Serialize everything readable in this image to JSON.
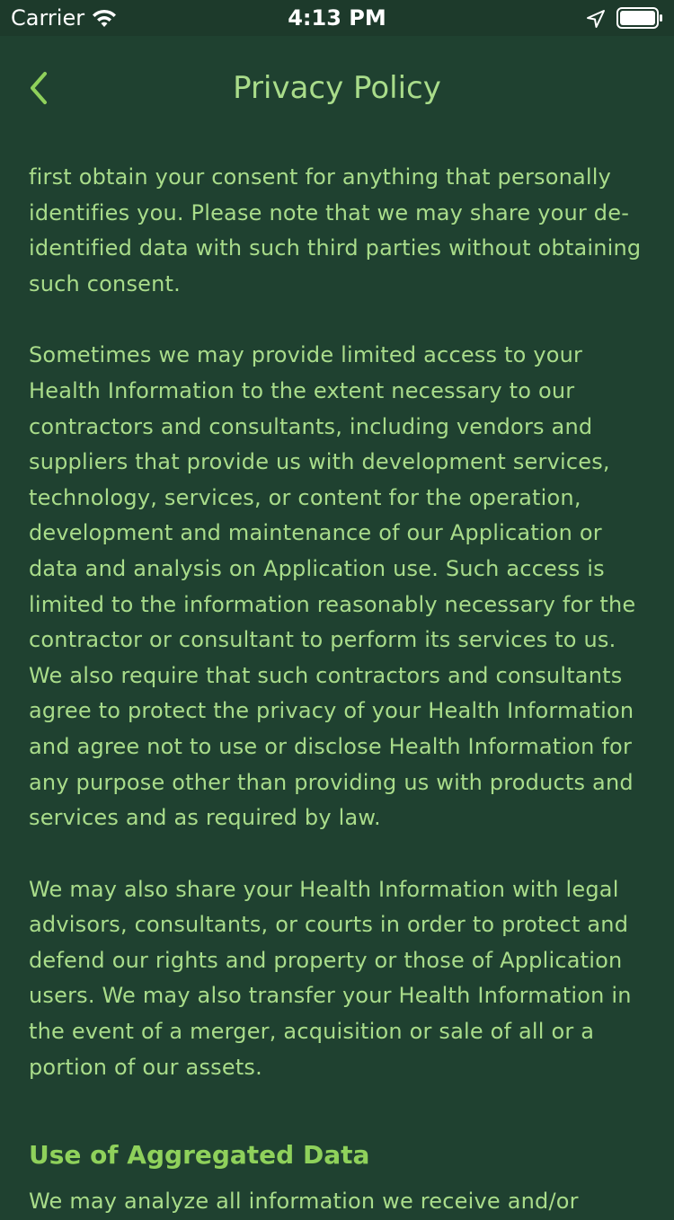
{
  "status_bar": {
    "carrier": "Carrier",
    "time": "4:13 PM",
    "icons": [
      "wifi-icon",
      "location-arrow-icon",
      "battery-icon"
    ]
  },
  "nav": {
    "title": "Privacy Policy",
    "back_icon": "chevron-left-icon"
  },
  "colors": {
    "background": "#1f4130",
    "status_bar": "#1d3a2b",
    "text": "#a9dc8a",
    "accent": "#8fd15b"
  },
  "content": {
    "paragraphs": [
      "first obtain your consent for anything that personally identifies you. Please note that we may share your de-identified data with such third parties without obtaining such consent.",
      "Sometimes we may provide limited access to your Health Information to the extent necessary to our contractors and consultants, including vendors and suppliers that provide us with development services, technology, services, or content for the operation, development and maintenance of our Application or data and analysis on Application use. Such access is limited to the information reasonably necessary for the contractor or consultant to perform its services to us. We also require that such contractors and consultants agree to protect the privacy of your Health Information and agree not to use or disclose Health Information for any purpose other than providing us with products and services and as required by law.",
      "We may also share your Health Information with legal advisors, consultants, or courts in order to protect and defend our rights and property or those of Application users. We may also transfer your Health Information in the event of a merger, acquisition or sale of all or a portion of our assets."
    ],
    "section_heading": "Use of Aggregated Data",
    "section_text": "We may analyze all information we receive and/or"
  }
}
